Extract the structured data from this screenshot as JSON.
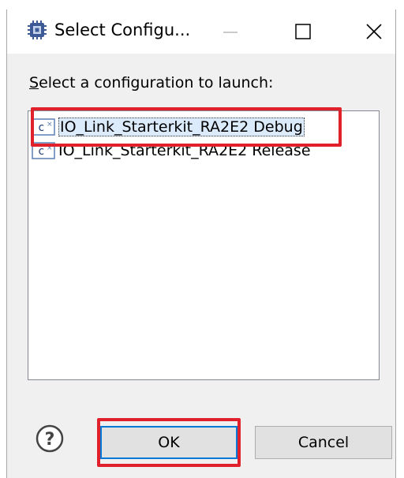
{
  "window": {
    "title": "Select Configu...",
    "icon": "configuration-chip-icon",
    "controls": {
      "minimize": "minimize-icon",
      "maximize": "maximize-icon",
      "close": "close-icon"
    }
  },
  "prompt": {
    "mnemonic": "S",
    "rest": "elect a configuration to launch:"
  },
  "configurations": [
    {
      "label": "IO_Link_Starterkit_RA2E2 Debug",
      "icon": "c-build-config-icon",
      "selected": true
    },
    {
      "label": "IO_Link_Starterkit_RA2E2 Release",
      "icon": "c-build-config-icon",
      "selected": false
    }
  ],
  "buttons": {
    "ok_label": "OK",
    "cancel_label": "Cancel",
    "help_icon": "help-icon"
  },
  "colors": {
    "highlight": "#e0202a",
    "dialog_bg": "#f0f0f0",
    "focus": "#0078d7",
    "selection_bg": "#dcebfc"
  }
}
